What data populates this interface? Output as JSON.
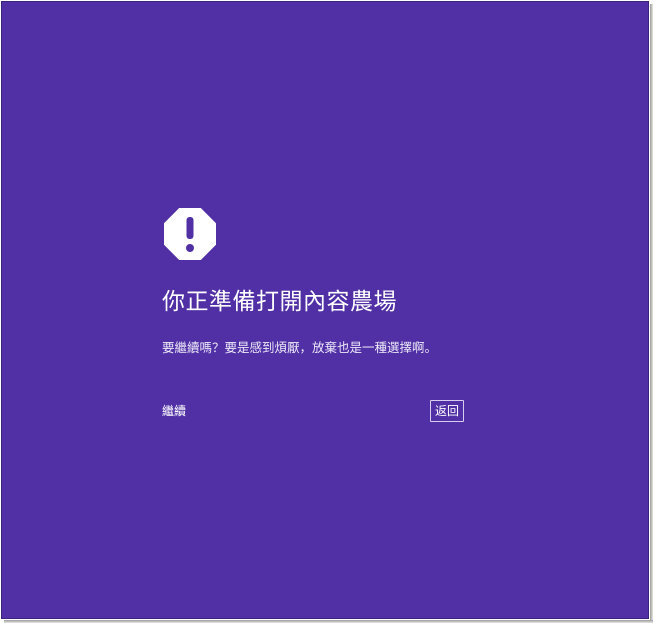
{
  "interstitial": {
    "icon": "warning-octagon-icon",
    "title": "你正準備打開內容農場",
    "message": "要繼續嗎？要是感到煩厭，放棄也是一種選擇啊。",
    "continue_label": "繼續",
    "back_label": "返回"
  },
  "colors": {
    "background": "#5130a6",
    "text": "#ffffff"
  }
}
